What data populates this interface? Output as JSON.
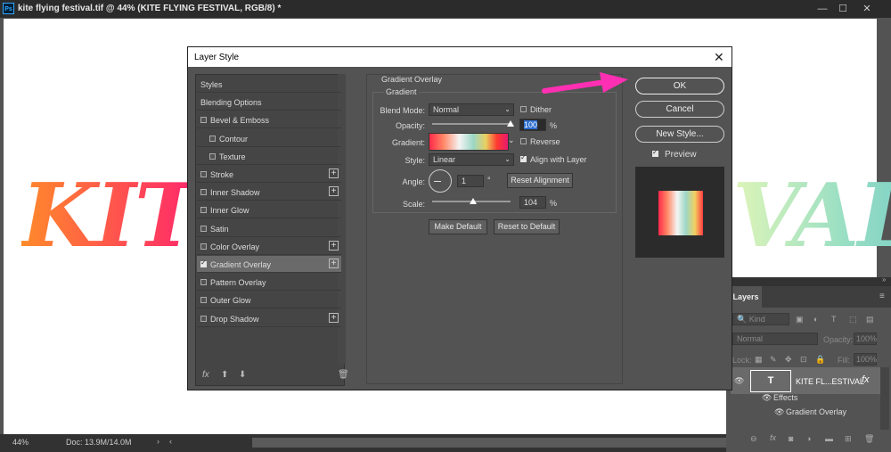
{
  "app": {
    "logo": "Ps",
    "document_title": "kite flying festival.tif @ 44% (KITE FLYING FESTIVAL, RGB/8) *",
    "win_min": "—",
    "win_max": "☐",
    "win_close": "✕"
  },
  "canvas_text": {
    "left": "KITE",
    "right": "VAL"
  },
  "status_bar": {
    "zoom": "44%",
    "doc_size": "Doc: 13.9M/14.0M",
    "arrow_right": "›",
    "arrow_left": "‹"
  },
  "dialog": {
    "title": "Layer Style",
    "close": "✕",
    "styles_list": [
      {
        "label": "Styles",
        "checkbox": false,
        "checked": false,
        "plus": false,
        "indent": 0,
        "selected": false
      },
      {
        "label": "Blending Options",
        "checkbox": false,
        "checked": false,
        "plus": false,
        "indent": 0,
        "selected": false
      },
      {
        "label": "Bevel & Emboss",
        "checkbox": true,
        "checked": false,
        "plus": false,
        "indent": 0,
        "selected": false
      },
      {
        "label": "Contour",
        "checkbox": true,
        "checked": false,
        "plus": false,
        "indent": 1,
        "selected": false
      },
      {
        "label": "Texture",
        "checkbox": true,
        "checked": false,
        "plus": false,
        "indent": 1,
        "selected": false
      },
      {
        "label": "Stroke",
        "checkbox": true,
        "checked": false,
        "plus": true,
        "indent": 0,
        "selected": false
      },
      {
        "label": "Inner Shadow",
        "checkbox": true,
        "checked": false,
        "plus": true,
        "indent": 0,
        "selected": false
      },
      {
        "label": "Inner Glow",
        "checkbox": true,
        "checked": false,
        "plus": false,
        "indent": 0,
        "selected": false
      },
      {
        "label": "Satin",
        "checkbox": true,
        "checked": false,
        "plus": false,
        "indent": 0,
        "selected": false
      },
      {
        "label": "Color Overlay",
        "checkbox": true,
        "checked": false,
        "plus": true,
        "indent": 0,
        "selected": false
      },
      {
        "label": "Gradient Overlay",
        "checkbox": true,
        "checked": true,
        "plus": true,
        "indent": 0,
        "selected": true
      },
      {
        "label": "Pattern Overlay",
        "checkbox": true,
        "checked": false,
        "plus": false,
        "indent": 0,
        "selected": false
      },
      {
        "label": "Outer Glow",
        "checkbox": true,
        "checked": false,
        "plus": false,
        "indent": 0,
        "selected": false
      },
      {
        "label": "Drop Shadow",
        "checkbox": true,
        "checked": false,
        "plus": true,
        "indent": 0,
        "selected": false
      }
    ],
    "styles_footer": {
      "fx": "fx",
      "up": "⬆",
      "down": "⬇",
      "trash": "🗑"
    },
    "gradient_overlay": {
      "section_title": "Gradient Overlay",
      "group_title": "Gradient",
      "blend_mode_label": "Blend Mode:",
      "blend_mode_value": "Normal",
      "dither_label": "Dither",
      "dither_checked": false,
      "opacity_label": "Opacity:",
      "opacity_value": "100",
      "opacity_unit": "%",
      "opacity_fraction": 1.0,
      "gradient_label": "Gradient:",
      "reverse_label": "Reverse",
      "reverse_checked": false,
      "style_label": "Style:",
      "style_value": "Linear",
      "align_label": "Align with Layer",
      "align_checked": true,
      "angle_label": "Angle:",
      "angle_value": "1",
      "angle_unit": "°",
      "reset_alignment": "Reset Alignment",
      "scale_label": "Scale:",
      "scale_value": "104",
      "scale_unit": "%",
      "scale_fraction": 0.52,
      "make_default": "Make Default",
      "reset_default": "Reset to Default"
    },
    "buttons": {
      "ok": "OK",
      "cancel": "Cancel",
      "new_style": "New Style..."
    },
    "preview_label": "Preview",
    "preview_checked": true
  },
  "layers_panel": {
    "tab": "Layers",
    "kind": "Kind",
    "blend": "Normal",
    "opacity_label": "Opacity:",
    "opacity_value": "100%",
    "lock_label": "Lock:",
    "fill_label": "Fill:",
    "fill_value": "100%",
    "layer_name": "KITE FL...ESTIVAL",
    "layer_thumb": "T",
    "fx": "fx",
    "effects_label": "Effects",
    "effect_item": "Gradient Overlay"
  },
  "colors": {
    "accent_arrow": "#ff2fb3",
    "selection": "#6a6a6a",
    "highlight_input": "#2d6fd1"
  }
}
